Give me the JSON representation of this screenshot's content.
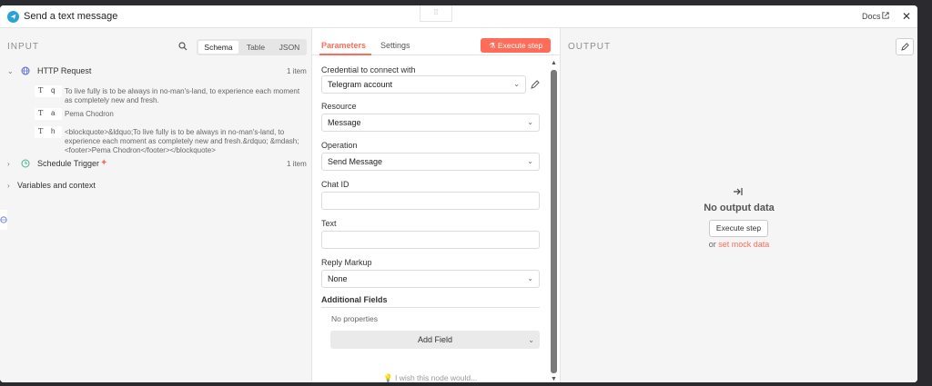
{
  "header": {
    "title": "Send a text message",
    "docs_label": "Docs",
    "drag_glyph": "⁞⁞"
  },
  "input_panel": {
    "label": "INPUT",
    "view_tabs": [
      "Schema",
      "Table",
      "JSON"
    ],
    "tree": [
      {
        "name": "HTTP Request",
        "count": "1 item",
        "fields": [
          {
            "type_glyph": "T",
            "key": "q",
            "value": "To live fully is to be always in no-man's-land, to experience each moment as completely new and fresh."
          },
          {
            "type_glyph": "T",
            "key": "a",
            "value": "Pema Chodron"
          },
          {
            "type_glyph": "T",
            "key": "h",
            "value": "<blockquote>&ldquo;To live fully is to be always in no-man's-land, to experience each moment as completely new and fresh.&rdquo; &mdash; <footer>Pema Chodron</footer></blockquote>"
          }
        ]
      },
      {
        "name": "Schedule Trigger",
        "count": "1 item"
      },
      {
        "name": "Variables and context"
      }
    ]
  },
  "parameters_panel": {
    "tabs": [
      "Parameters",
      "Settings"
    ],
    "execute_label": "Execute step",
    "credential": {
      "label": "Credential to connect with",
      "value": "Telegram account"
    },
    "resource": {
      "label": "Resource",
      "value": "Message"
    },
    "operation": {
      "label": "Operation",
      "value": "Send Message"
    },
    "chat_id": {
      "label": "Chat ID",
      "value": ""
    },
    "text": {
      "label": "Text",
      "value": ""
    },
    "reply_markup": {
      "label": "Reply Markup",
      "value": "None"
    },
    "additional_fields": {
      "label": "Additional Fields",
      "empty_text": "No properties",
      "add_label": "Add Field"
    },
    "wish_text": "I wish this node would..."
  },
  "output_panel": {
    "label": "OUTPUT",
    "empty_title": "No output data",
    "execute_label": "Execute step",
    "or_text": "or",
    "mock_link": "set mock data"
  },
  "colors": {
    "accent": "#ff6d5a",
    "telegram": "#2aa3d9",
    "panel_bg": "#f5f5f5",
    "backdrop": "#2b2b2f"
  }
}
